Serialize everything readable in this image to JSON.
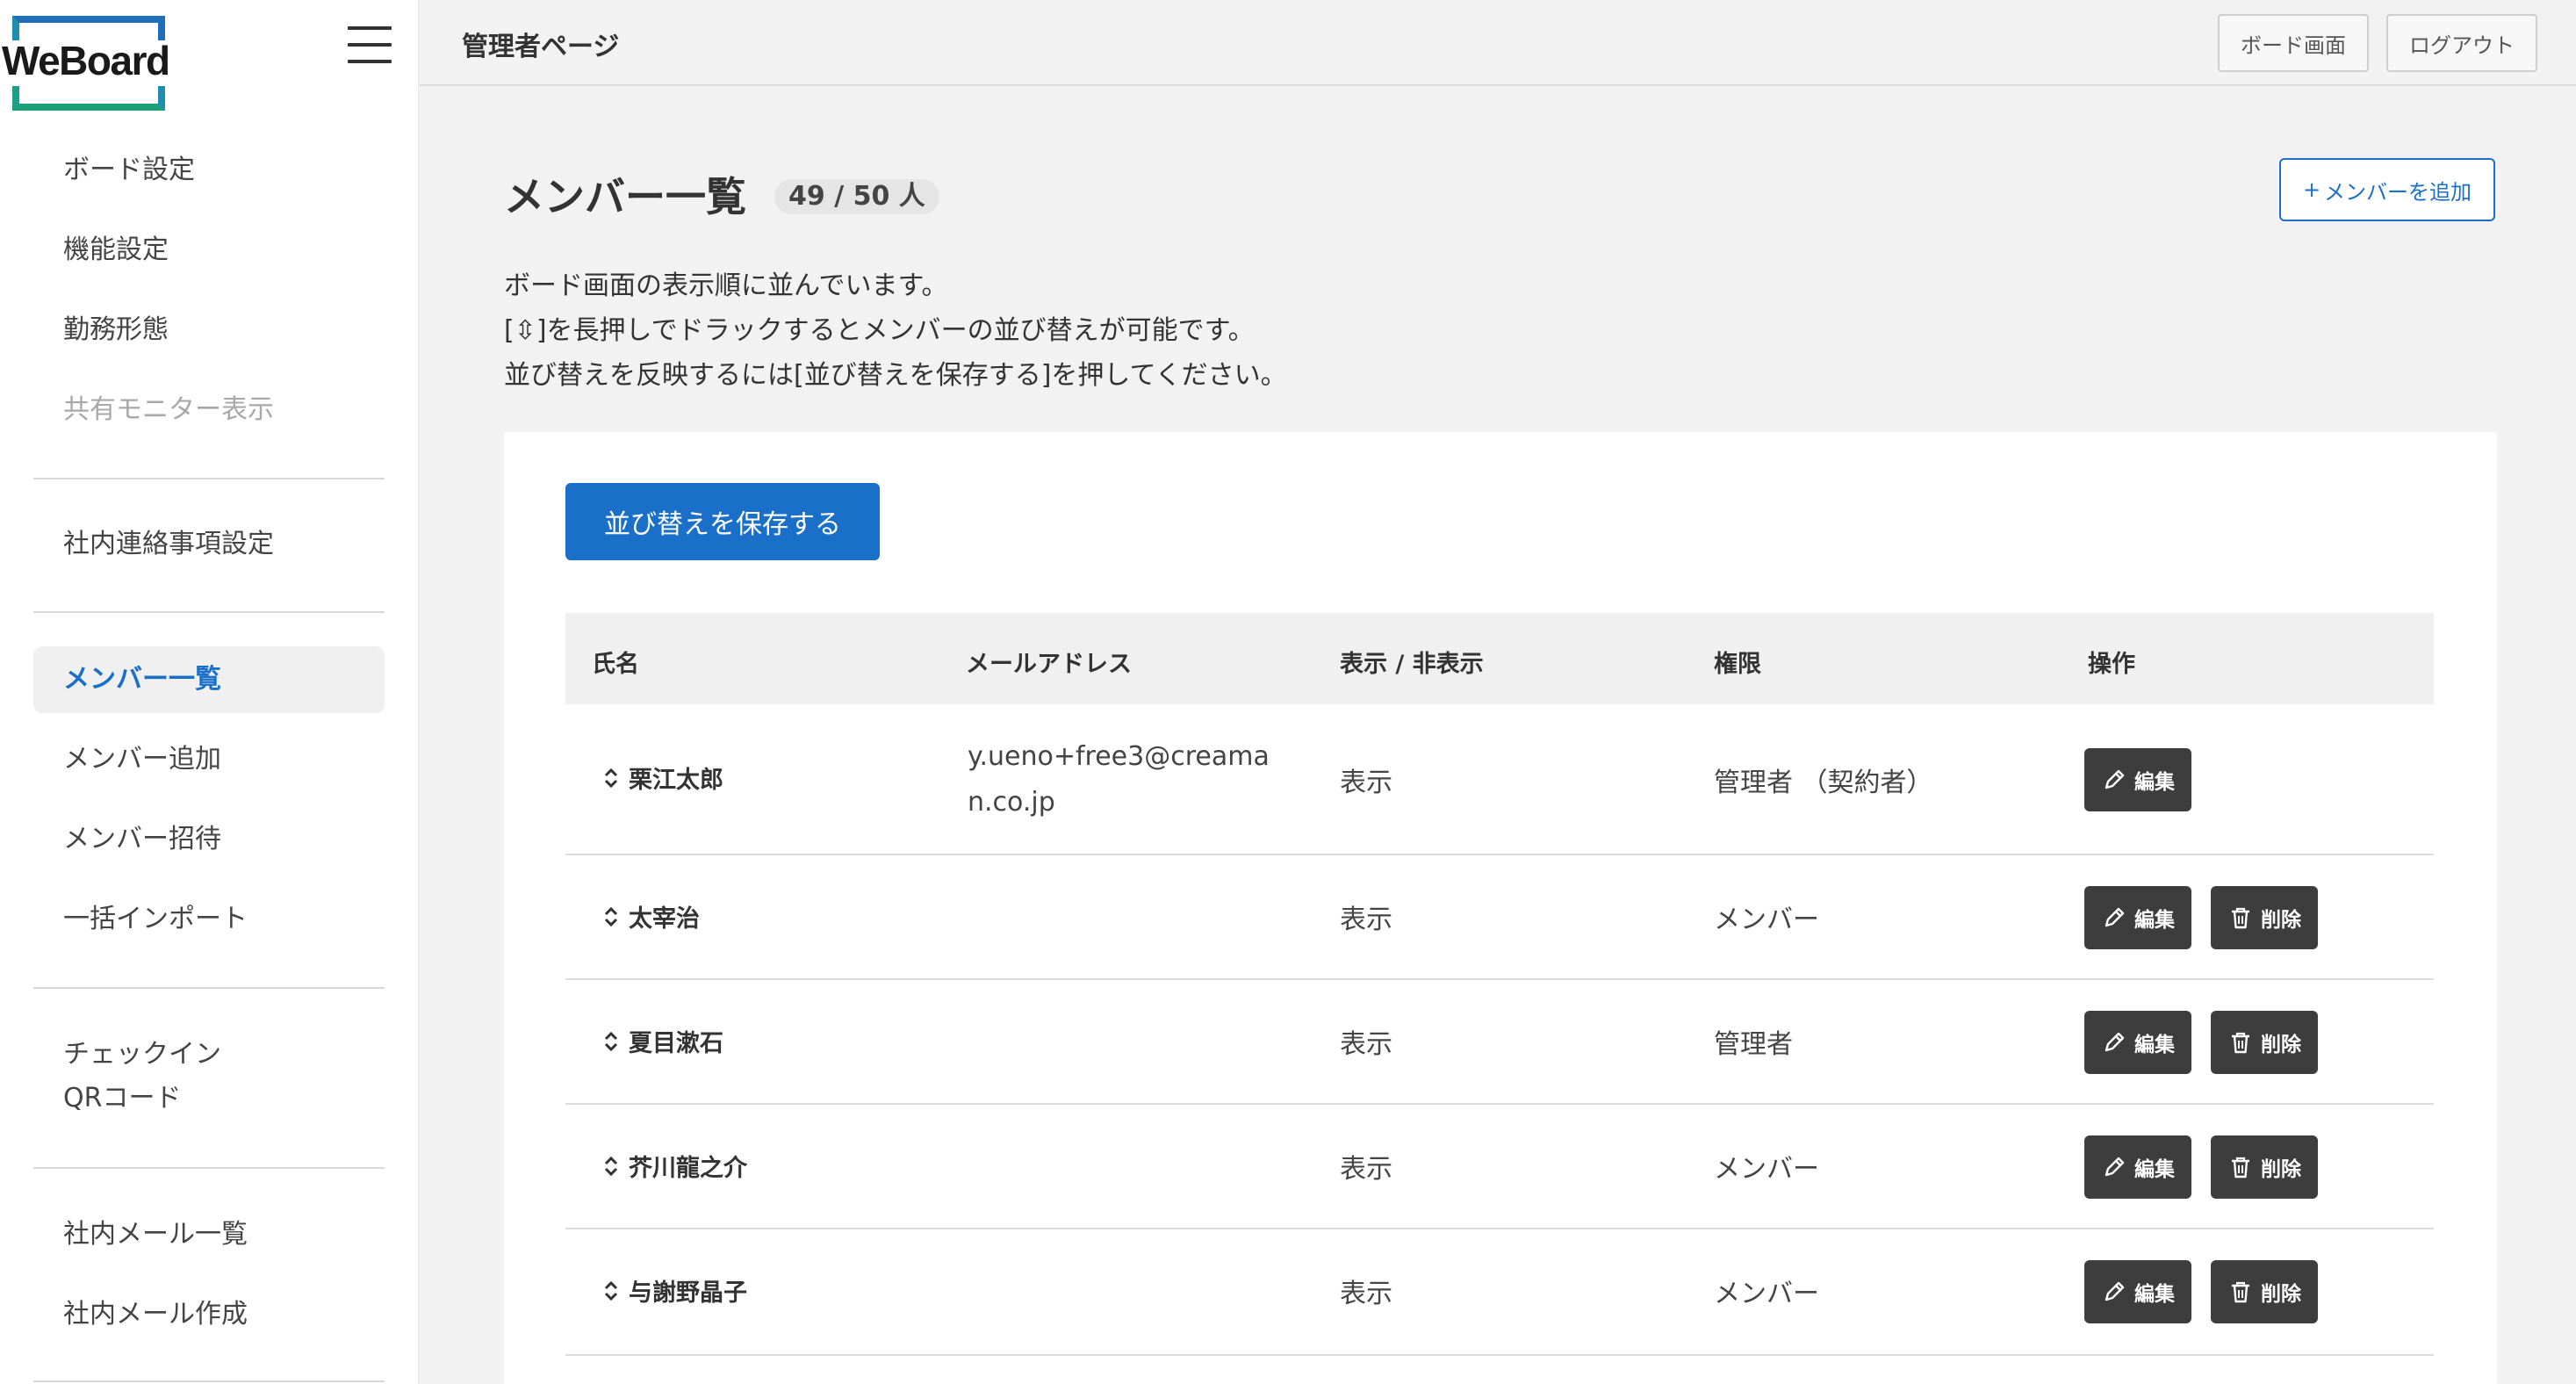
{
  "logo": {
    "text": "WeBoard"
  },
  "sidebar": {
    "items": [
      {
        "label": "ボード設定"
      },
      {
        "label": "機能設定"
      },
      {
        "label": "勤務形態"
      },
      {
        "label": "共有モニター表示"
      },
      {
        "label": "社内連絡事項設定"
      },
      {
        "label": "メンバー一覧"
      },
      {
        "label": "メンバー追加"
      },
      {
        "label": "メンバー招待"
      },
      {
        "label": "一括インポート"
      },
      {
        "label": "チェックイン"
      },
      {
        "label": "QRコード"
      },
      {
        "label": "社内メール一覧"
      },
      {
        "label": "社内メール作成"
      }
    ]
  },
  "header": {
    "title": "管理者ページ",
    "board_button": "ボード画面",
    "logout_button": "ログアウト"
  },
  "main": {
    "title": "メンバー一覧",
    "count": "49 / 50 人",
    "add_button": "メンバーを追加",
    "add_button_prefix": "+",
    "description": [
      "ボード画面の表示順に並んでいます。",
      "[⇳]を長押しでドラックするとメンバーの並び替えが可能です。",
      "並び替えを反映するには[並び替えを保存する]を押してください。"
    ],
    "save_order_button": "並び替えを保存する"
  },
  "table": {
    "columns": [
      "氏名",
      "メールアドレス",
      "表示 / 非表示",
      "権限",
      "操作"
    ],
    "edit_label": "編集",
    "delete_label": "削除",
    "rows": [
      {
        "name": "栗江太郎",
        "email_line1": "y.ueno+free3@creama",
        "email_line2": "n.co.jp",
        "visibility": "表示",
        "role": "管理者 （契約者）"
      },
      {
        "name": "太宰治",
        "email_line1": "",
        "email_line2": "",
        "visibility": "表示",
        "role": "メンバー"
      },
      {
        "name": "夏目漱石",
        "email_line1": "",
        "email_line2": "",
        "visibility": "表示",
        "role": "管理者"
      },
      {
        "name": "芥川龍之介",
        "email_line1": "",
        "email_line2": "",
        "visibility": "表示",
        "role": "メンバー"
      },
      {
        "name": "与謝野晶子",
        "email_line1": "",
        "email_line2": "",
        "visibility": "表示",
        "role": "メンバー"
      }
    ]
  },
  "colors": {
    "accent": "#1a6fc9",
    "dark_button": "#3d3d3d",
    "page_bg": "#f2f2f2"
  }
}
